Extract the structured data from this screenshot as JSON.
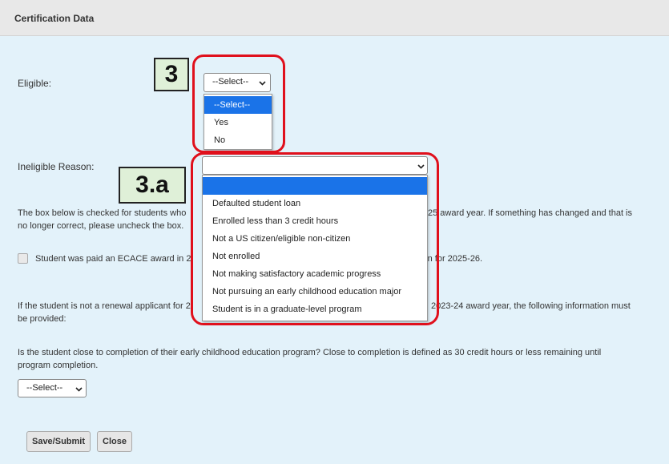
{
  "header": {
    "title": "Certification Data"
  },
  "eligible": {
    "label": "Eligible:",
    "selected": "--Select--",
    "options": [
      "--Select--",
      "Yes",
      "No"
    ]
  },
  "ineligible_reason": {
    "label": "Ineligible Reason:",
    "selected": "",
    "options": [
      "",
      "Defaulted student loan",
      "Enrolled less than 3 credit hours",
      "Not a US citizen/eligible non-citizen",
      "Not enrolled",
      "Not making satisfactory academic progress",
      "Not pursuing an early childhood education major",
      "Student is in a graduate-level program"
    ]
  },
  "annotations": {
    "eligible_badge": "3",
    "reason_badge": "3.a"
  },
  "texts": {
    "box_note_left": "The box below is checked for students who",
    "box_note_right": "25 award year. If something has changed and that is",
    "box_note_line2": "no longer correct, please uncheck the box.",
    "checkbox_label_left": "Student was paid an ECACE award in 2",
    "checkbox_label_right": "tion for 2025-26.",
    "renewal_left": "If the student is not a renewal applicant for 2",
    "renewal_right": "2023-24 award year, the following information must",
    "renewal_line2": "be provided:",
    "completion_q_line1": "Is the student close to completion of their early childhood education program? Close to completion is defined as 30 credit hours or less remaining until",
    "completion_q_line2": "program completion."
  },
  "completion": {
    "selected": "--Select--"
  },
  "buttons": {
    "save_submit": "Save/Submit",
    "close": "Close"
  },
  "colors": {
    "panel_bg": "#e3f2fa",
    "highlight": "#1a73e8",
    "annotation_red": "#e0101c",
    "badge_bg": "#dff0d8"
  }
}
